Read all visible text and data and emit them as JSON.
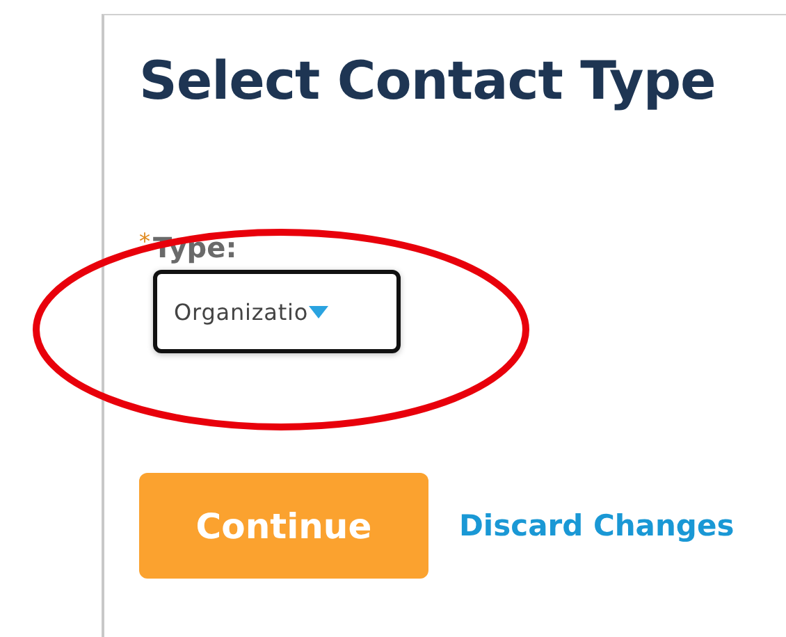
{
  "title": "Select Contact Type",
  "field": {
    "required_mark": "*",
    "label": "Type:",
    "value": "Organizatio"
  },
  "buttons": [
    {
      "kind": "primary",
      "label": "Continue"
    },
    {
      "kind": "link",
      "label": "Discard Changes"
    }
  ],
  "annotation": {
    "kind": "ellipse"
  }
}
